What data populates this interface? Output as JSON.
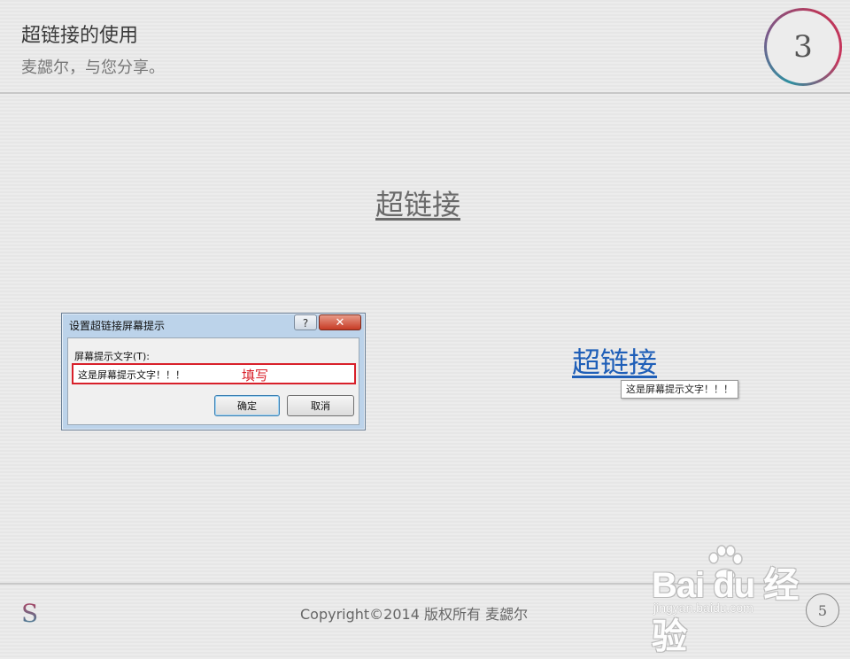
{
  "header": {
    "title": "超链接的使用",
    "subtitle": "麦勰尔，与您分享。",
    "step_number": "3",
    "ring_colors": [
      "#b8385a",
      "#2e8fa0"
    ]
  },
  "slide": {
    "hyperlink_text_grey": "超链接",
    "hyperlink_text_blue": "超链接",
    "tooltip_text": "这是屏幕提示文字！！！",
    "link_color": "#1f5fb8"
  },
  "dialog": {
    "title": "设置超链接屏幕提示",
    "help_label": "?",
    "close_label": "✕",
    "field_label": "屏幕提示文字(T):",
    "field_value": "这是屏幕提示文字！！！",
    "fill_note": "填写",
    "ok_label": "确定",
    "cancel_label": "取消",
    "highlight_color": "#d8202a"
  },
  "footer": {
    "logo_letter": "S",
    "copyright": "Copyright©2014 版权所有 麦勰尔",
    "page_number": "5"
  },
  "watermark": {
    "brand": "Bai du 经验",
    "url": "jingyan.baidu.com",
    "icon": "paw-icon"
  }
}
